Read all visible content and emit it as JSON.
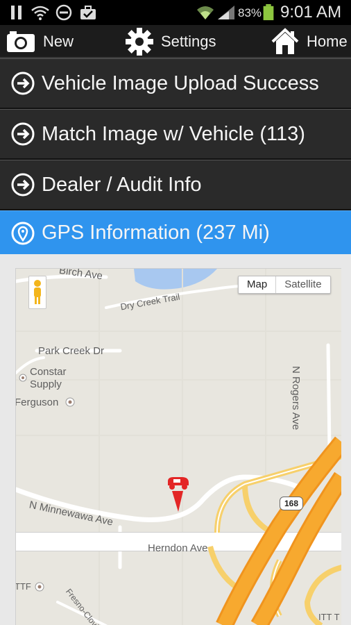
{
  "status_bar": {
    "battery_percent": "83%",
    "time": "9:01 AM",
    "icons": [
      "pause-icon",
      "wifi-icon",
      "do-not-disturb-icon",
      "briefcase-icon",
      "wifi-signal-icon",
      "cell-signal-icon",
      "battery-icon"
    ]
  },
  "action_bar": {
    "new_label": "New",
    "settings_label": "Settings",
    "home_label": "Home"
  },
  "list": {
    "items": [
      {
        "label": "Vehicle Image Upload Success",
        "icon": "arrow-right-circle-icon"
      },
      {
        "label": "Match Image w/ Vehicle (113)",
        "icon": "arrow-right-circle-icon"
      },
      {
        "label": "Dealer / Audit Info",
        "icon": "arrow-right-circle-icon"
      },
      {
        "label": "GPS Information (237 Mi)",
        "icon": "location-pin-icon",
        "active": true
      }
    ]
  },
  "map": {
    "type_toggle": {
      "map_label": "Map",
      "satellite_label": "Satellite",
      "selected": "Map"
    },
    "labels": {
      "birch": "Birch Ave",
      "dry_creek": "Dry Creek Trail",
      "park_creek": "Park Creek Dr",
      "constar": "Constar",
      "supply": "Supply",
      "ferguson": "Ferguson",
      "rogers": "N Rogers Ave",
      "minnewawa": "N Minnewawa Ave",
      "herndon": "Herndon Ave",
      "route": "168",
      "ttf": "TTF",
      "fresno": "Fresno-Clovis Re",
      "itt": "ITT T"
    }
  },
  "colors": {
    "active_row": "#2f94ee",
    "row_bg": "#2a2a2a",
    "highway": "#f6a42a",
    "marker": "#e32626"
  }
}
